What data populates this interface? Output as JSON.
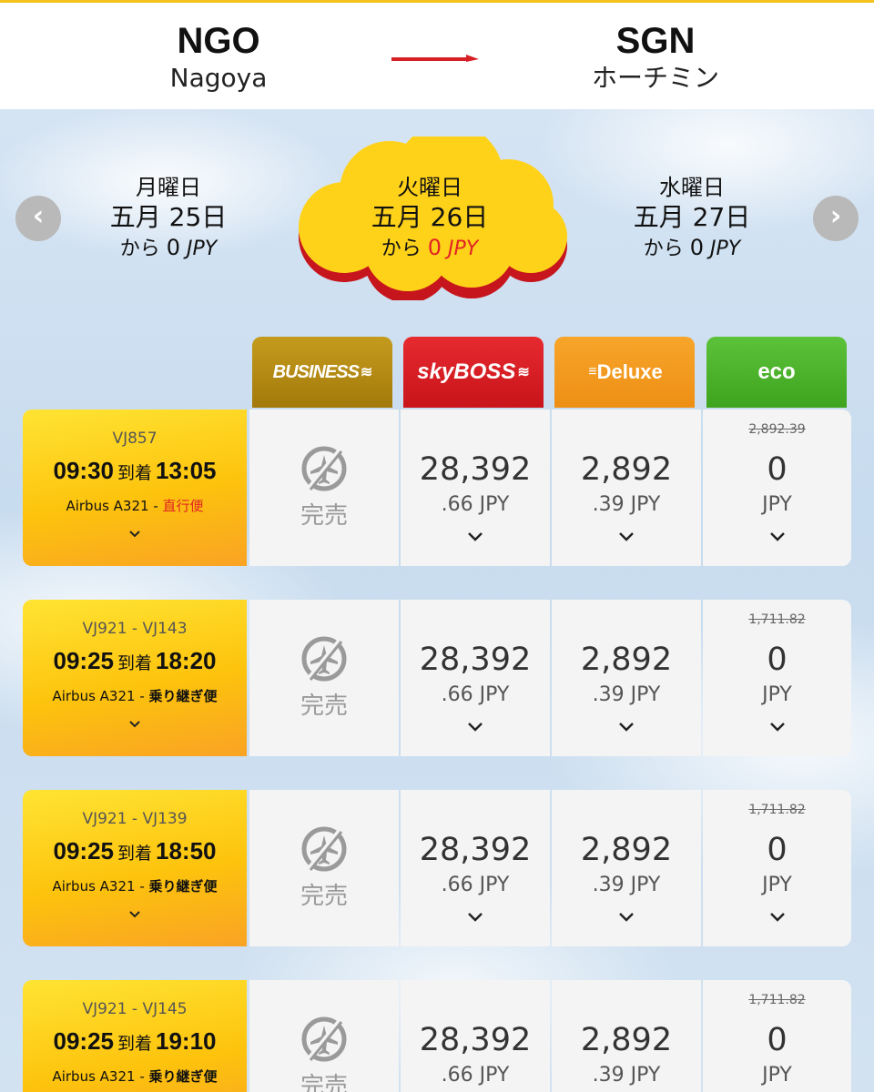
{
  "route": {
    "from_code": "NGO",
    "from_city": "Nagoya",
    "to_code": "SGN",
    "to_city": "ホーチミン"
  },
  "date_nav": {
    "prev_icon": "chevron-left-icon",
    "next_icon": "chevron-right-icon",
    "dates": [
      {
        "day": "月曜日",
        "date": "五月 25日",
        "prefix": "から",
        "amount": "0",
        "currency": "JPY",
        "selected": false
      },
      {
        "day": "火曜日",
        "date": "五月 26日",
        "prefix": "から",
        "amount": "0",
        "currency": "JPY",
        "selected": true
      },
      {
        "day": "水曜日",
        "date": "五月 27日",
        "prefix": "から",
        "amount": "0",
        "currency": "JPY",
        "selected": false
      }
    ]
  },
  "fare_classes": [
    {
      "label": "BUSINESS",
      "color": "#b88c14"
    },
    {
      "label": "skyBOSS",
      "color": "#e0262c"
    },
    {
      "label": "Deluxe",
      "color": "#f39a20"
    },
    {
      "label": "eco",
      "color": "#4fb52d"
    }
  ],
  "flights": [
    {
      "code": "VJ857",
      "depart": "09:30",
      "arrive_label": "到着",
      "arrive": "13:05",
      "aircraft": "Airbus A321 -",
      "type": "直行便",
      "business": "完売",
      "skyboss": {
        "main": "28,392",
        "sub": ".66 JPY"
      },
      "deluxe": {
        "main": "2,892",
        "sub": ".39 JPY"
      },
      "eco": {
        "old": "2,892.39",
        "main": "0",
        "sub": "JPY"
      }
    },
    {
      "code": "VJ921 - VJ143",
      "depart": "09:25",
      "arrive_label": "到着",
      "arrive": "18:20",
      "aircraft": "Airbus A321 -",
      "type": "乗り継ぎ便",
      "business": "完売",
      "skyboss": {
        "main": "28,392",
        "sub": ".66 JPY"
      },
      "deluxe": {
        "main": "2,892",
        "sub": ".39 JPY"
      },
      "eco": {
        "old": "1,711.82",
        "main": "0",
        "sub": "JPY"
      }
    },
    {
      "code": "VJ921 - VJ139",
      "depart": "09:25",
      "arrive_label": "到着",
      "arrive": "18:50",
      "aircraft": "Airbus A321 -",
      "type": "乗り継ぎ便",
      "business": "完売",
      "skyboss": {
        "main": "28,392",
        "sub": ".66 JPY"
      },
      "deluxe": {
        "main": "2,892",
        "sub": ".39 JPY"
      },
      "eco": {
        "old": "1,711.82",
        "main": "0",
        "sub": "JPY"
      }
    },
    {
      "code": "VJ921 - VJ145",
      "depart": "09:25",
      "arrive_label": "到着",
      "arrive": "19:10",
      "aircraft": "Airbus A321 -",
      "type": "乗り継ぎ便",
      "business": "完売",
      "skyboss": {
        "main": "28,392",
        "sub": ".66 JPY"
      },
      "deluxe": {
        "main": "2,892",
        "sub": ".39 JPY"
      },
      "eco": {
        "old": "1,711.82",
        "main": "0",
        "sub": "JPY"
      }
    }
  ],
  "colors": {
    "accent_red": "#e02424",
    "brand_yellow": "#fdc30d",
    "cell_bg": "#f4f4f4",
    "sold_out_grey": "#9a9a9a"
  }
}
